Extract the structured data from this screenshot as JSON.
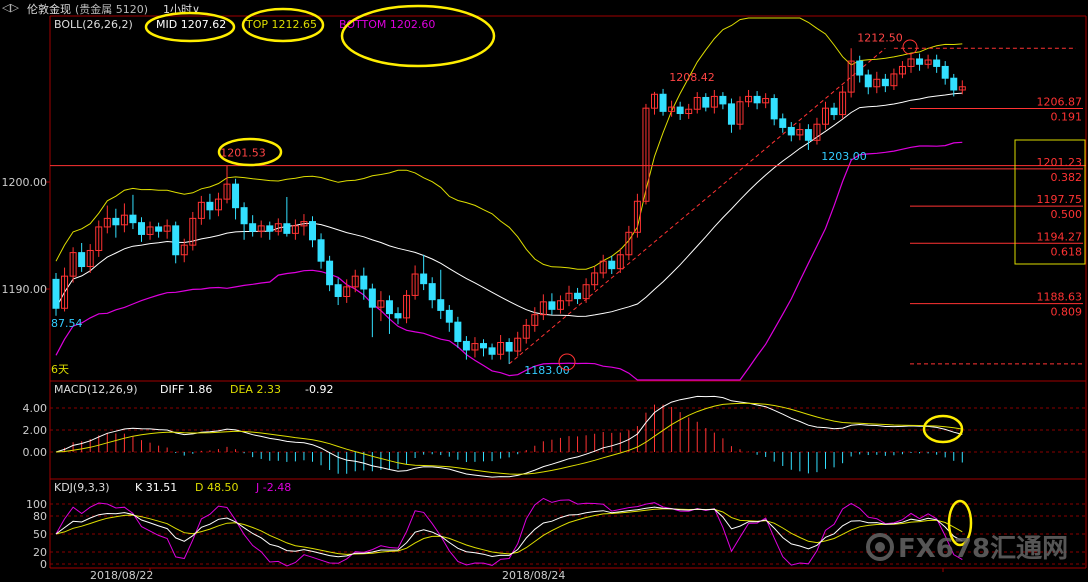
{
  "window": {
    "symbol": "伦敦金现",
    "market": "贵金属",
    "code": "5120",
    "period": "1小时"
  },
  "main_panel": {
    "indicator": "BOLL(26,26,2)",
    "mid_label": "MID",
    "mid_value": "1207.62",
    "top_label": "TOP",
    "top_value": "1212.65",
    "bottom_label": "BOTTOM",
    "bottom_value": "1202.60",
    "y_ticks": [
      "1200.00",
      "1190.00"
    ],
    "y_tick_values": [
      1200,
      1190
    ],
    "left_edge_value": "87.54",
    "days_label": "6天",
    "annotations": [
      {
        "text": "1201.53",
        "price": 1201.53,
        "color": "#ff4444"
      },
      {
        "text": "1208.42",
        "price": 1208.42,
        "color": "#ff4444"
      },
      {
        "text": "1212.50",
        "price": 1212.5,
        "color": "#ff4444"
      },
      {
        "text": "1203.00",
        "price": 1203.0,
        "color": "#33ccff"
      },
      {
        "text": "1183.00",
        "price": 1183.0,
        "color": "#33ccff"
      }
    ],
    "fib_levels": [
      {
        "price": "1206.87",
        "ratio": "0.191"
      },
      {
        "price": "1201.23",
        "ratio": "0.382"
      },
      {
        "price": "1197.75",
        "ratio": "0.500"
      },
      {
        "price": "1194.27",
        "ratio": "0.618"
      },
      {
        "price": "1188.63",
        "ratio": "0.809"
      }
    ]
  },
  "macd_panel": {
    "indicator": "MACD(12,26,9)",
    "diff_label": "DIFF",
    "diff_value": "1.86",
    "dea_label": "DEA",
    "dea_value": "2.33",
    "macd_value": "-0.92",
    "y_ticks": [
      "4.00",
      "2.00",
      "0.00"
    ],
    "y_tick_values": [
      4,
      2,
      0
    ]
  },
  "kdj_panel": {
    "indicator": "KDJ(9,3,3)",
    "k_label": "K",
    "k_value": "31.51",
    "d_label": "D",
    "d_value": "48.50",
    "j_label": "J",
    "j_value": "-2.48",
    "y_ticks": [
      "100",
      "80",
      "50",
      "20",
      "0"
    ],
    "y_tick_values": [
      100,
      80,
      50,
      20,
      0
    ]
  },
  "x_axis": {
    "dates": [
      "2018/08/22",
      "2018/08/24"
    ]
  },
  "watermark": {
    "text": "FX678汇通网"
  },
  "colors": {
    "up": "#ff3333",
    "down": "#33e0ff",
    "mid": "#ffffff",
    "upper": "#dddd00",
    "lower": "#dd00dd",
    "grid": "#8a0000",
    "highlight": "#ffee00",
    "k": "#ffffff",
    "d": "#dddd00",
    "j": "#dd00dd"
  },
  "chart_data": {
    "type": "candlestick",
    "series": [
      {
        "name": "K-line",
        "values": [
          [
            1190.9,
            1188.2,
            1191.5,
            1187.5
          ],
          [
            1188.2,
            1191.2,
            1192.0,
            1187.9
          ],
          [
            1191.2,
            1193.4,
            1193.9,
            1190.6
          ],
          [
            1193.4,
            1192.1,
            1194.3,
            1191.6
          ],
          [
            1192.1,
            1193.6,
            1194.2,
            1191.5
          ],
          [
            1193.6,
            1195.8,
            1196.4,
            1193.0
          ],
          [
            1195.8,
            1196.6,
            1197.8,
            1195.2
          ],
          [
            1196.6,
            1196.0,
            1197.5,
            1194.8
          ],
          [
            1196.0,
            1196.9,
            1198.0,
            1195.3
          ],
          [
            1196.9,
            1196.2,
            1198.8,
            1195.6
          ],
          [
            1196.2,
            1195.1,
            1196.7,
            1194.4
          ],
          [
            1195.1,
            1195.8,
            1196.3,
            1194.6
          ],
          [
            1195.8,
            1195.4,
            1196.2,
            1194.8
          ],
          [
            1195.4,
            1195.9,
            1196.5,
            1194.7
          ],
          [
            1195.9,
            1193.2,
            1196.3,
            1192.4
          ],
          [
            1193.2,
            1194.1,
            1194.7,
            1192.5
          ],
          [
            1194.1,
            1196.6,
            1197.2,
            1193.6
          ],
          [
            1196.6,
            1198.1,
            1198.7,
            1196.0
          ],
          [
            1198.1,
            1197.4,
            1198.9,
            1196.5
          ],
          [
            1197.4,
            1198.4,
            1199.0,
            1196.8
          ],
          [
            1198.4,
            1199.8,
            1201.53,
            1198.0
          ],
          [
            1199.8,
            1197.6,
            1200.3,
            1196.5
          ],
          [
            1197.6,
            1196.1,
            1198.1,
            1194.6
          ],
          [
            1196.1,
            1195.4,
            1196.9,
            1194.9
          ],
          [
            1195.4,
            1195.9,
            1196.4,
            1194.8
          ],
          [
            1195.9,
            1195.4,
            1196.3,
            1194.6
          ],
          [
            1195.4,
            1196.1,
            1196.6,
            1195.0
          ],
          [
            1196.1,
            1195.2,
            1198.6,
            1194.9
          ],
          [
            1195.2,
            1195.9,
            1196.5,
            1194.6
          ],
          [
            1195.9,
            1196.3,
            1197.0,
            1195.0
          ],
          [
            1196.3,
            1194.6,
            1196.8,
            1193.9
          ],
          [
            1194.6,
            1192.6,
            1195.2,
            1191.9
          ],
          [
            1192.6,
            1190.4,
            1193.1,
            1189.8
          ],
          [
            1190.4,
            1189.3,
            1191.0,
            1188.5
          ],
          [
            1189.3,
            1190.2,
            1190.9,
            1188.7
          ],
          [
            1190.2,
            1191.2,
            1191.8,
            1189.7
          ],
          [
            1191.2,
            1190.0,
            1192.0,
            1189.0
          ],
          [
            1190.0,
            1188.3,
            1190.5,
            1185.5
          ],
          [
            1188.3,
            1188.9,
            1189.8,
            1187.0
          ],
          [
            1188.9,
            1187.7,
            1189.4,
            1185.8
          ],
          [
            1187.7,
            1187.3,
            1188.3,
            1186.7
          ],
          [
            1187.3,
            1189.4,
            1189.9,
            1186.8
          ],
          [
            1189.4,
            1191.4,
            1192.2,
            1189.0
          ],
          [
            1191.4,
            1190.5,
            1193.2,
            1189.9
          ],
          [
            1190.5,
            1189.0,
            1191.1,
            1188.2
          ],
          [
            1189.0,
            1188.0,
            1191.8,
            1187.2
          ],
          [
            1188.0,
            1186.9,
            1188.5,
            1186.0
          ],
          [
            1186.9,
            1185.1,
            1187.4,
            1184.5
          ],
          [
            1185.1,
            1184.3,
            1185.6,
            1183.4
          ],
          [
            1184.3,
            1184.9,
            1185.5,
            1183.6
          ],
          [
            1184.9,
            1184.5,
            1185.3,
            1183.7
          ],
          [
            1184.5,
            1183.9,
            1184.9,
            1183.4
          ],
          [
            1183.9,
            1185.0,
            1185.7,
            1183.4
          ],
          [
            1185.0,
            1184.2,
            1185.4,
            1183.0
          ],
          [
            1184.2,
            1185.4,
            1186.0,
            1183.7
          ],
          [
            1185.4,
            1186.6,
            1187.2,
            1184.9
          ],
          [
            1186.6,
            1187.6,
            1188.3,
            1186.0
          ],
          [
            1187.6,
            1188.8,
            1189.5,
            1187.1
          ],
          [
            1188.8,
            1188.1,
            1189.6,
            1187.6
          ],
          [
            1188.1,
            1188.9,
            1189.4,
            1187.7
          ],
          [
            1188.9,
            1189.6,
            1190.3,
            1188.4
          ],
          [
            1189.6,
            1189.1,
            1190.1,
            1188.6
          ],
          [
            1189.1,
            1190.4,
            1191.0,
            1188.7
          ],
          [
            1190.4,
            1191.5,
            1192.1,
            1189.9
          ],
          [
            1191.5,
            1192.6,
            1193.2,
            1191.0
          ],
          [
            1192.6,
            1191.9,
            1193.1,
            1191.4
          ],
          [
            1191.9,
            1193.2,
            1193.8,
            1191.5
          ],
          [
            1193.2,
            1195.3,
            1195.9,
            1192.7
          ],
          [
            1195.3,
            1198.2,
            1198.9,
            1194.8
          ],
          [
            1198.2,
            1206.9,
            1207.3,
            1197.9
          ],
          [
            1206.9,
            1208.2,
            1208.42,
            1206.3
          ],
          [
            1208.2,
            1206.6,
            1208.7,
            1206.2
          ],
          [
            1206.6,
            1207.0,
            1207.6,
            1206.1
          ],
          [
            1207.0,
            1206.4,
            1207.5,
            1205.8
          ],
          [
            1206.4,
            1206.8,
            1207.3,
            1205.9
          ],
          [
            1206.8,
            1207.9,
            1208.4,
            1206.4
          ],
          [
            1207.9,
            1207.0,
            1208.3,
            1206.6
          ],
          [
            1207.0,
            1208.0,
            1208.6,
            1206.4
          ],
          [
            1208.0,
            1207.3,
            1208.4,
            1206.8
          ],
          [
            1207.3,
            1205.4,
            1207.8,
            1204.6
          ],
          [
            1205.4,
            1207.5,
            1208.0,
            1204.9
          ],
          [
            1207.5,
            1208.0,
            1208.6,
            1207.0
          ],
          [
            1208.0,
            1207.4,
            1208.5,
            1206.8
          ],
          [
            1207.4,
            1207.8,
            1208.3,
            1206.9
          ],
          [
            1207.8,
            1205.9,
            1208.2,
            1205.3
          ],
          [
            1205.9,
            1205.1,
            1206.4,
            1204.6
          ],
          [
            1205.1,
            1204.4,
            1205.6,
            1203.8
          ],
          [
            1204.4,
            1204.9,
            1205.5,
            1203.9
          ],
          [
            1204.9,
            1203.9,
            1205.4,
            1203.0
          ],
          [
            1203.9,
            1205.4,
            1206.0,
            1203.5
          ],
          [
            1205.4,
            1206.9,
            1207.5,
            1204.9
          ],
          [
            1206.9,
            1206.3,
            1207.4,
            1205.8
          ],
          [
            1206.3,
            1208.4,
            1209.0,
            1205.9
          ],
          [
            1208.4,
            1211.3,
            1212.5,
            1207.9
          ],
          [
            1211.3,
            1210.0,
            1211.8,
            1209.3
          ],
          [
            1210.0,
            1208.9,
            1210.5,
            1208.2
          ],
          [
            1208.9,
            1209.6,
            1210.3,
            1208.3
          ],
          [
            1209.6,
            1209.0,
            1210.1,
            1208.4
          ],
          [
            1209.0,
            1210.1,
            1210.6,
            1208.6
          ],
          [
            1210.1,
            1210.8,
            1211.3,
            1209.7
          ],
          [
            1210.8,
            1211.5,
            1212.0,
            1210.2
          ],
          [
            1211.5,
            1211.0,
            1212.0,
            1210.4
          ],
          [
            1211.0,
            1211.4,
            1211.9,
            1210.6
          ],
          [
            1211.4,
            1210.8,
            1211.9,
            1210.2
          ],
          [
            1210.8,
            1209.7,
            1211.3,
            1209.1
          ],
          [
            1209.7,
            1208.6,
            1210.1,
            1208.0
          ],
          [
            1208.6,
            1208.9,
            1209.5,
            1208.2
          ]
        ]
      }
    ],
    "y_range": [
      1182,
      1215
    ],
    "overlays": [
      "BOLL MID",
      "BOLL TOP",
      "BOLL BOTTOM",
      "fibonacci"
    ]
  }
}
